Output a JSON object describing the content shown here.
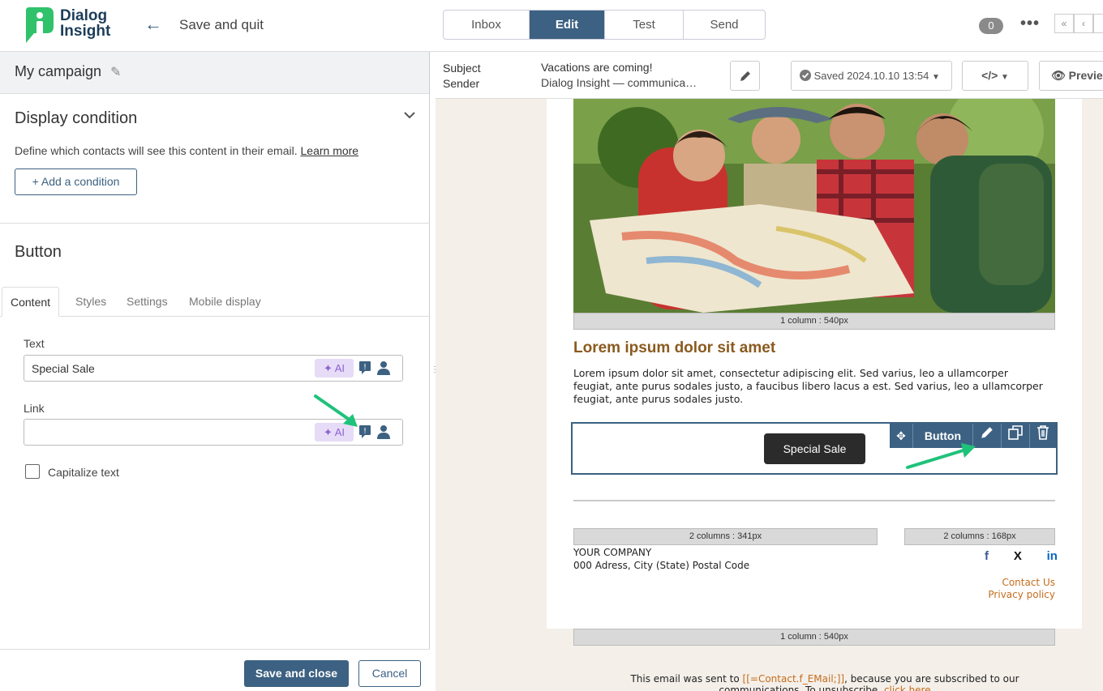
{
  "app": {
    "logo_line1": "Dialog",
    "logo_line2": "Insight",
    "back_label": "Save and quit",
    "badge_count": "0"
  },
  "tabs": [
    {
      "label": "Inbox"
    },
    {
      "label": "Edit"
    },
    {
      "label": "Test"
    },
    {
      "label": "Send"
    }
  ],
  "pager": [
    "«",
    "‹"
  ],
  "left_panel": {
    "campaign_name": "My campaign",
    "display_condition": {
      "title": "Display condition",
      "description": "Define which contacts will see this content in their email.",
      "learn_more": "Learn more",
      "add_button": "+ Add a condition"
    },
    "section_title": "Button",
    "subtabs": [
      "Content",
      "Styles",
      "Settings",
      "Mobile display"
    ],
    "text_field": {
      "label": "Text",
      "value": "Special Sale"
    },
    "link_field": {
      "label": "Link",
      "value": ""
    },
    "ai_label": "AI",
    "capitalize_label": "Capitalize text",
    "save_close": "Save and close",
    "cancel": "Cancel"
  },
  "email_header": {
    "subject_label": "Subject",
    "sender_label": "Sender",
    "subject_value": "Vacations are coming!",
    "sender_value": "Dialog Insight  —  communica…",
    "saved_status": "Saved 2024.10.10 13:54",
    "code_label": "</>",
    "preview_label": "Previe"
  },
  "email": {
    "col_top": "1 column : 540px",
    "headline": "Lorem ipsum dolor sit amet",
    "paragraph": "Lorem ipsum dolor sit amet, consectetur adipiscing elit. Sed varius, leo a ullamcorper feugiat, ante purus sodales justo, a faucibus libero lacus a est. Sed varius, leo a ullamcorper feugiat, ante purus sodales justo.",
    "toolbar_label": "Button",
    "cta": "Special Sale",
    "col_left": "2 columns : 341px",
    "col_right": "2 columns : 168px",
    "company": "YOUR COMPANY",
    "address": "000 Adress, City (State) Postal Code",
    "social": [
      "f",
      "X",
      "in"
    ],
    "contact_us": "Contact Us",
    "privacy": "Privacy policy",
    "col_bottom": "1 column : 540px",
    "footer_pre": "This email was sent to ",
    "footer_token": "[[=Contact.f_EMail;]]",
    "footer_post": ", because you are subscribed to our",
    "footer_line2": "communications. To unsubscribe, ",
    "footer_link": "click here"
  },
  "colors": {
    "primary": "#3c6182",
    "accent_orange": "#c46d1d",
    "ai_bg": "#e7dcf7",
    "annotation_arrow": "#1fc27a"
  }
}
